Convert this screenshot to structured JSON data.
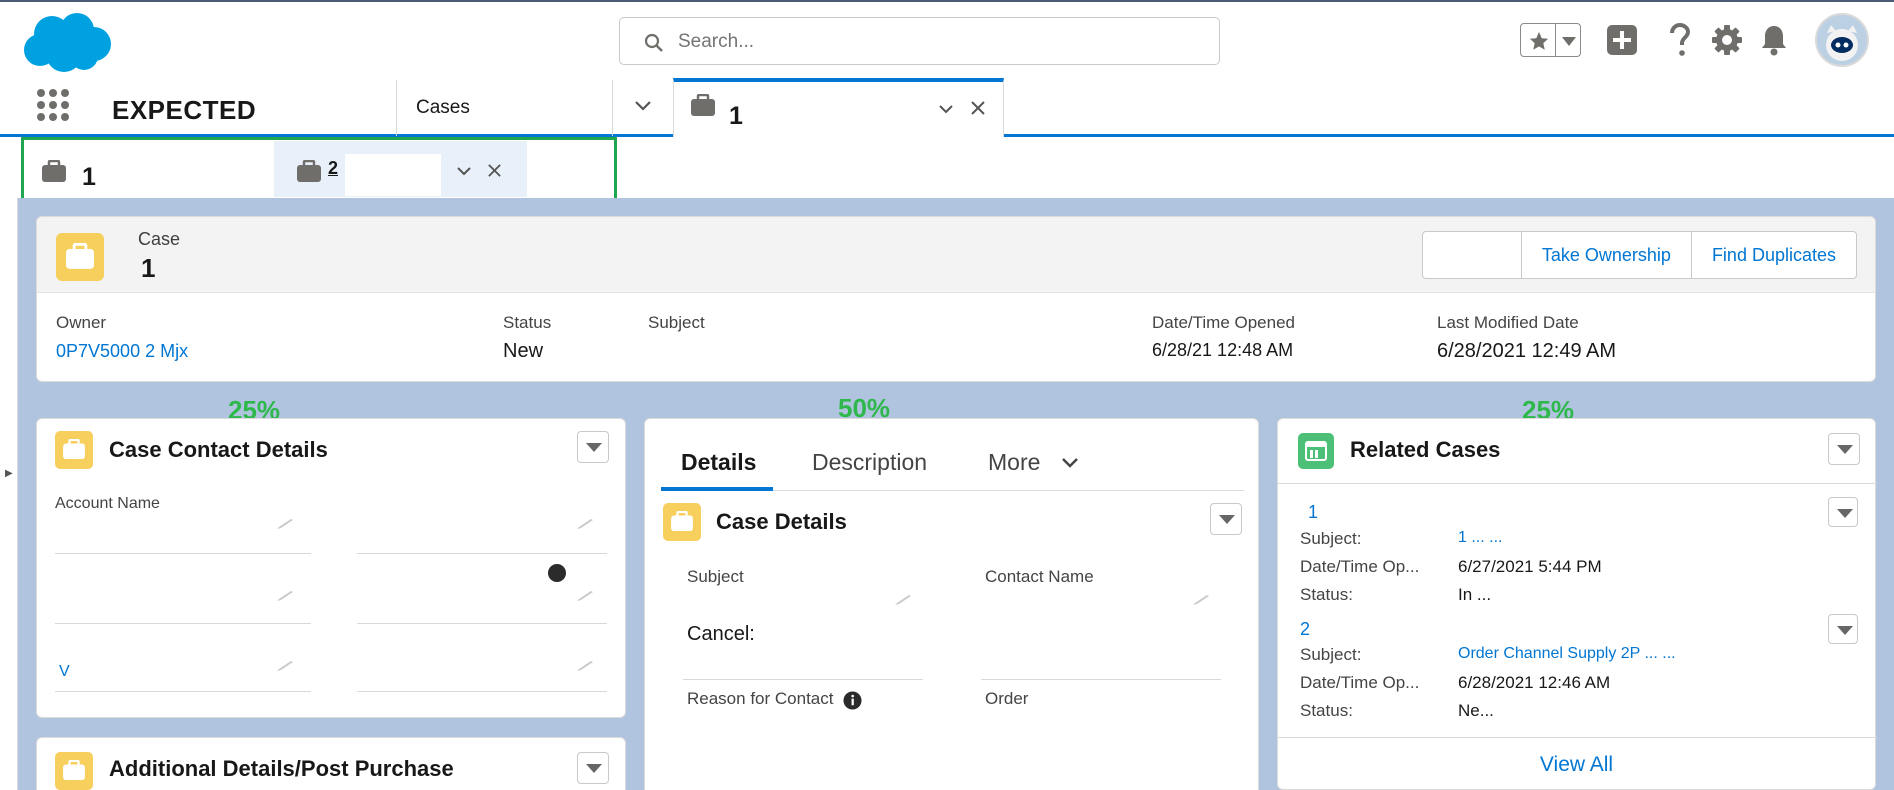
{
  "header": {
    "search_placeholder": "Search...",
    "icons": [
      "salesforce-logo",
      "search-icon",
      "star-icon",
      "chevron-down-icon",
      "add-icon",
      "help-icon",
      "setup-gear-icon",
      "bell-icon",
      "avatar"
    ]
  },
  "nav": {
    "app_name": "EXPECTED",
    "items": [
      {
        "label": "Cases"
      }
    ],
    "active_tab": {
      "label": "1"
    }
  },
  "subtabs": [
    {
      "label": "1"
    },
    {
      "label": "2"
    }
  ],
  "highlights": {
    "object_type": "Case",
    "record_number": "1",
    "buttons": [
      "",
      "Take Ownership",
      "Find Duplicates"
    ],
    "fields": [
      {
        "label": "Owner",
        "value": "0P7V5000 2 Mjx"
      },
      {
        "label": "Status",
        "value": "New"
      },
      {
        "label": "Subject",
        "value": ""
      },
      {
        "label": "Date/Time Opened",
        "value": "6/28/21 12:48 AM"
      },
      {
        "label": "Last Modified Date",
        "value": "6/28/2021 12:49 AM"
      }
    ]
  },
  "annotations": {
    "left": "25%",
    "middle": "50%",
    "right": "25%"
  },
  "left_card": {
    "title": "Case Contact Details",
    "field1_label": "Account Name",
    "bottom_link": "V",
    "bottom_card_title": "Additional Details/Post Purchase"
  },
  "middle_card": {
    "tabs": [
      "Details",
      "Description",
      "More"
    ],
    "section_title": "Case Details",
    "fields": [
      {
        "label": "Subject",
        "value": "Cancel:"
      },
      {
        "label": "Contact Name",
        "value": ""
      },
      {
        "label": "Reason for Contact",
        "value": ""
      },
      {
        "label": "Order",
        "value": ""
      }
    ]
  },
  "right_card": {
    "title": "Related Cases",
    "items": [
      {
        "num": "1",
        "subject_label": "Subject:",
        "subject_value": "1 ... ...",
        "date_label": "Date/Time Op...",
        "date_value": "6/27/2021 5:44 PM",
        "status_label": "Status:",
        "status_value": "In ..."
      },
      {
        "num": "2",
        "subject_label": "Subject:",
        "subject_value": "Order Channel Supply 2P ... ...",
        "date_label": "Date/Time Op...",
        "date_value": "6/28/2021 12:46 AM",
        "status_label": "Status:",
        "status_value": "Ne..."
      }
    ],
    "view_all": "View All"
  }
}
